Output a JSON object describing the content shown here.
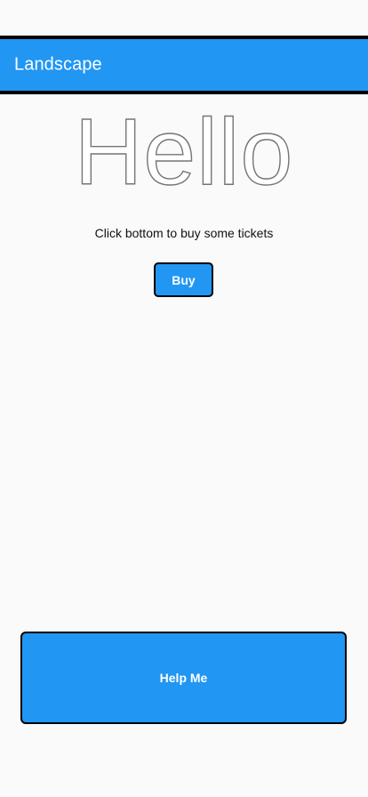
{
  "app_bar": {
    "title": "Landscape"
  },
  "main": {
    "headline": "Hello",
    "description": "Click bottom to buy some tickets",
    "buy_label": "Buy"
  },
  "footer": {
    "help_label": "Help Me"
  },
  "colors": {
    "accent": "#2196f3",
    "border": "#000000",
    "background": "#fafafa",
    "headline_stroke": "#757575"
  }
}
